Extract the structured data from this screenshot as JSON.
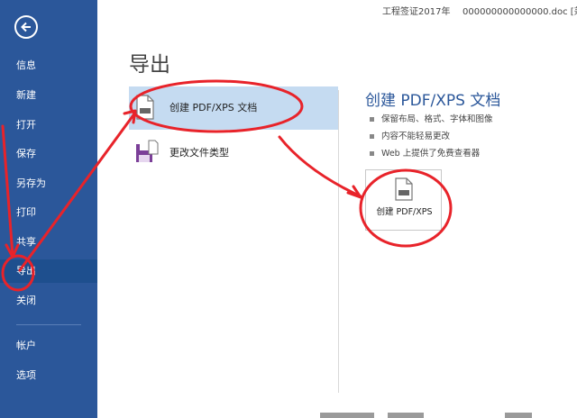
{
  "window": {
    "doc_title": "工程签证2017年",
    "filename": "000000000000000.doc [兼"
  },
  "sidebar": {
    "items": [
      {
        "label": "信息"
      },
      {
        "label": "新建"
      },
      {
        "label": "打开"
      },
      {
        "label": "保存"
      },
      {
        "label": "另存为"
      },
      {
        "label": "打印"
      },
      {
        "label": "共享"
      },
      {
        "label": "导出"
      },
      {
        "label": "关闭"
      },
      {
        "label": "帐户"
      },
      {
        "label": "选项"
      }
    ],
    "active_item": "导出",
    "bg_color": "#2b579a"
  },
  "main": {
    "title": "导出",
    "options": [
      {
        "label": "创建 PDF/XPS 文档",
        "icon": "pdf-document-icon",
        "selected": true
      },
      {
        "label": "更改文件类型",
        "icon": "change-file-type-icon",
        "selected": false
      }
    ]
  },
  "detail": {
    "title": "创建 PDF/XPS 文档",
    "bullets": [
      "保留布局、格式、字体和图像",
      "内容不能轻易更改",
      "Web 上提供了免费查看器"
    ],
    "action_button_label": "创建 PDF/XPS",
    "action_button_icon": "pdf-xps-icon"
  },
  "annotations": {
    "color": "#e8232a",
    "shapes": [
      "circle-around-export-nav",
      "circle-around-pdf-option",
      "circle-around-create-button",
      "arrows-connecting-circles"
    ]
  }
}
